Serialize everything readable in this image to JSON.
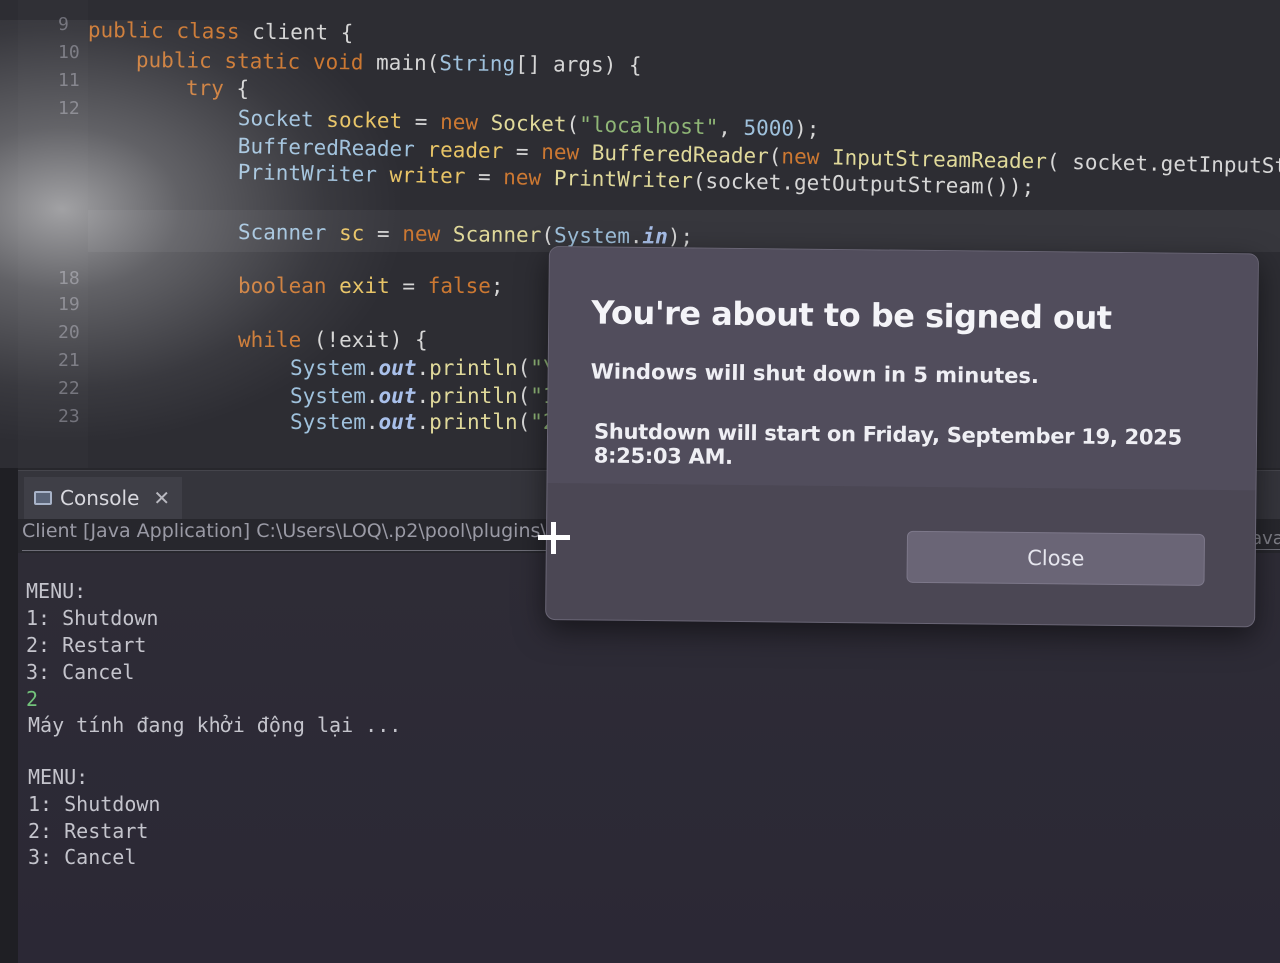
{
  "editor": {
    "gutter_numbers": [
      "9",
      "10",
      "11",
      "12",
      "",
      "",
      "",
      "",
      "",
      "18",
      "19",
      "20",
      "21",
      "22",
      "23"
    ],
    "lines": [
      "public class client {",
      "    public static void main(String[] args) {",
      "        try {",
      "            Socket socket = new Socket(\"localhost\", 5000);",
      "            BufferedReader reader = new BufferedReader(new InputStreamReader( socket.getInputStream",
      "            PrintWriter writer = new PrintWriter(socket.getOutputStream());",
      "            Scanner sc = new Scanner(System.in);",
      "            boolean exit = false;",
      "            while (!exit) {",
      "                System.out.println(\"\\",
      "                System.out.println(\"1",
      "                System.out.println(\"2"
    ]
  },
  "console": {
    "tab_label": "Console",
    "tab_close": "✕",
    "run_path": "Client [Java Application] C:\\Users\\LOQ\\.p2\\pool\\plugins\\",
    "run_path_end": "\\java",
    "output": [
      {
        "text": "MENU:",
        "type": "out"
      },
      {
        "text": "1: Shutdown",
        "type": "out"
      },
      {
        "text": "2: Restart",
        "type": "out"
      },
      {
        "text": "3: Cancel",
        "type": "out"
      },
      {
        "text": "2",
        "type": "input"
      },
      {
        "text": "Máy tính đang khởi động lại ...",
        "type": "out"
      },
      {
        "text": "",
        "type": "out"
      },
      {
        "text": "MENU:",
        "type": "out"
      },
      {
        "text": "1: Shutdown",
        "type": "out"
      },
      {
        "text": "2: Restart",
        "type": "out"
      },
      {
        "text": "3: Cancel",
        "type": "out"
      }
    ]
  },
  "dialog": {
    "title": "You're about to be signed out",
    "message": "Windows will shut down in 5 minutes.",
    "detail": "Shutdown will start on Friday, September 19, 2025 8:25:03 AM.",
    "close_label": "Close"
  }
}
